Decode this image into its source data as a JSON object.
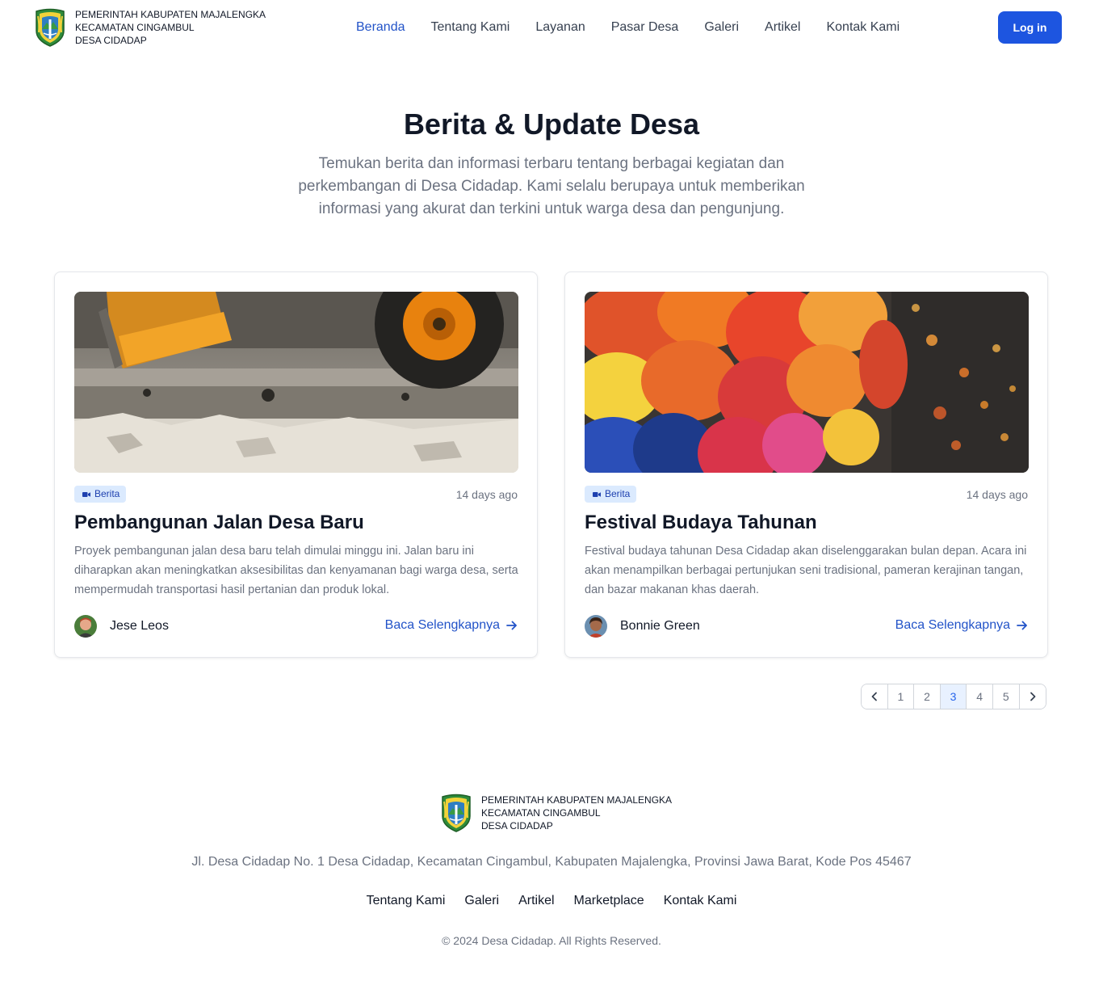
{
  "brand": {
    "line1": "PEMERINTAH KABUPATEN MAJALENGKA",
    "line2": "KECAMATAN CINGAMBUL",
    "line3": "DESA CIDADAP",
    "logo_icon": "regency-crest-icon"
  },
  "nav": {
    "items": [
      {
        "label": "Beranda",
        "active": true
      },
      {
        "label": "Tentang Kami"
      },
      {
        "label": "Layanan"
      },
      {
        "label": "Pasar Desa"
      },
      {
        "label": "Galeri"
      },
      {
        "label": "Artikel"
      },
      {
        "label": "Kontak Kami"
      }
    ],
    "login_label": "Log in"
  },
  "hero": {
    "title": "Berita & Update Desa",
    "subtitle": "Temukan berita dan informasi terbaru tentang berbagai kegiatan dan perkembangan di Desa Cidadap. Kami selalu berupaya untuk memberikan informasi yang akurat dan terkini untuk warga desa dan pengunjung."
  },
  "articles": [
    {
      "category": "Berita",
      "time": "14 days ago",
      "title": "Pembangunan Jalan Desa Baru",
      "description": "Proyek pembangunan jalan desa baru telah dimulai minggu ini. Jalan baru ini diharapkan akan meningkatkan aksesibilitas dan kenyamanan bagi warga desa, serta mempermudah transportasi hasil pertanian dan produk lokal.",
      "author": "Jese Leos",
      "read_more": "Baca Selengkapnya",
      "image_icon": "road-construction-photo"
    },
    {
      "category": "Berita",
      "time": "14 days ago",
      "title": "Festival Budaya Tahunan",
      "description": "Festival budaya tahunan Desa Cidadap akan diselenggarakan bulan depan. Acara ini akan menampilkan berbagai pertunjukan seni tradisional, pameran kerajinan tangan, dan bazar makanan khas daerah.",
      "author": "Bonnie Green",
      "read_more": "Baca Selengkapnya",
      "image_icon": "lantern-festival-photo"
    }
  ],
  "pagination": {
    "pages": [
      "1",
      "2",
      "3",
      "4",
      "5"
    ],
    "current": "3"
  },
  "footer": {
    "address": "Jl. Desa Cidadap No. 1 Desa Cidadap, Kecamatan Cingambul, Kabupaten Majalengka, Provinsi Jawa Barat, Kode Pos 45467",
    "links": [
      "Tentang Kami",
      "Galeri",
      "Artikel",
      "Marketplace",
      "Kontak Kami"
    ],
    "copyright": "© 2024 Desa Cidadap. All Rights Reserved."
  },
  "colors": {
    "primary": "#1d55e0",
    "nav_active": "#2253c8",
    "badge_bg": "#dbeafe",
    "badge_text": "#1e40af"
  }
}
